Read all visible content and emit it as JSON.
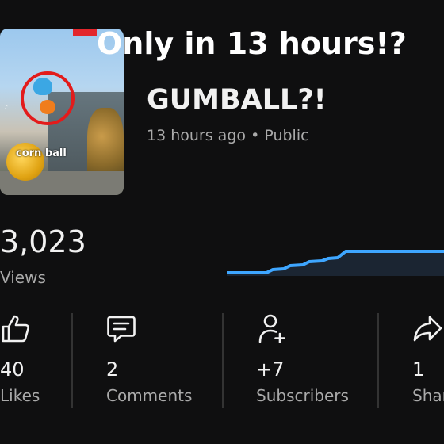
{
  "overlay": {
    "headline": "Only in 13 hours!?"
  },
  "video": {
    "title": "GUMBALL?!",
    "time_ago": "13 hours ago",
    "separator": "•",
    "visibility": "Public",
    "thumbnail": {
      "ball_label": "corn ball"
    }
  },
  "views": {
    "value": "3,023",
    "label": "Views"
  },
  "stats": [
    {
      "value": "40",
      "label": "Likes",
      "icon": "thumbs-up-icon"
    },
    {
      "value": "2",
      "label": "Comments",
      "icon": "comment-icon"
    },
    {
      "value": "+7",
      "label": "Subscribers",
      "icon": "add-person-icon"
    },
    {
      "value": "1",
      "label": "Shar",
      "icon": "share-icon"
    }
  ],
  "colors": {
    "accent": "#3ea6ff",
    "background": "#0f0f10",
    "muted": "#aaaaaa"
  }
}
